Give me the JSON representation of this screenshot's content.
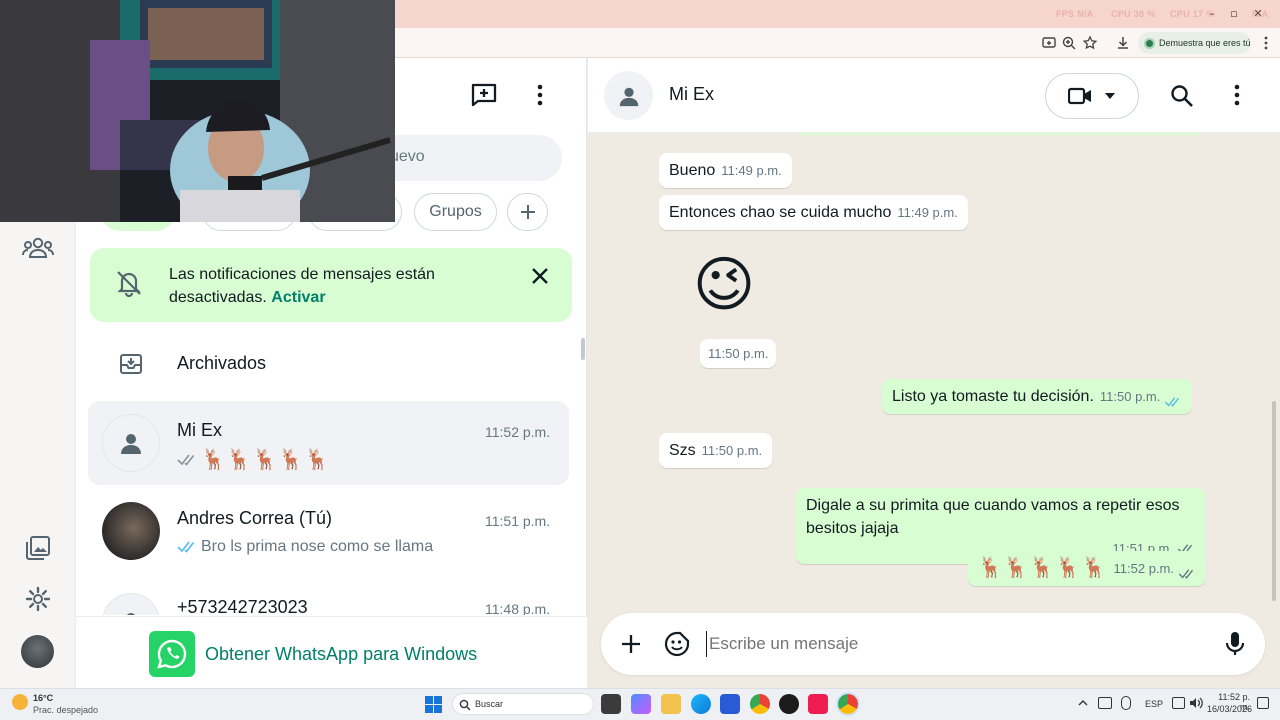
{
  "browser": {
    "perf": [
      "FPS N/A",
      "CPU 38 %",
      "CPU 17 %",
      "N/A"
    ],
    "verify_pill": "Demuestra que eres tú"
  },
  "sidebar": {
    "search_placeholder": "uevo",
    "filters": [
      "Grupos"
    ],
    "notification": {
      "text": "Las notificaciones de mensajes están desactivadas.",
      "action": "Activar"
    },
    "archived_label": "Archivados",
    "chats": [
      {
        "name": "Mi Ex",
        "time": "11:52 p.m.",
        "preview": "🦌🦌🦌🦌🦌"
      },
      {
        "name": "Andres Correa (Tú)",
        "time": "11:51 p.m.",
        "preview": "Bro ls prima nose como se llama"
      },
      {
        "name": "+573242723023",
        "time": "11:48 p.m.",
        "preview": ""
      }
    ],
    "get_app": "Obtener WhatsApp para Windows"
  },
  "conversation": {
    "contact_name": "Mi Ex",
    "messages": [
      {
        "dir": "in",
        "text": "Bueno",
        "time": "11:49 p.m."
      },
      {
        "dir": "in",
        "text": "Entonces chao se cuida mucho",
        "time": "11:49 p.m."
      },
      {
        "dir": "in",
        "text": "😉",
        "time": "11:50 p.m."
      },
      {
        "dir": "out",
        "text": "Listo ya tomaste tu decisión.",
        "time": "11:50 p.m.",
        "status": "read"
      },
      {
        "dir": "in",
        "text": "Szs",
        "time": "11:50 p.m."
      },
      {
        "dir": "out",
        "text": "Digale a su primita que cuando vamos a repetir esos besitos jajaja",
        "time": "11:51 p.m.",
        "status": "delivered"
      },
      {
        "dir": "out",
        "text": "🦌🦌🦌🦌🦌",
        "time": "11:52 p.m.",
        "status": "delivered"
      }
    ],
    "composer_placeholder": "Escribe un mensaje"
  },
  "taskbar": {
    "weather_temp": "16°C",
    "weather_desc": "Prac. despejado",
    "search_label": "Buscar",
    "lang": "ESP",
    "time": "11:52 p. m.",
    "date": "16/03/2026"
  },
  "colors": {
    "accent": "#008069",
    "outgoing_bubble": "#d9fdd3",
    "read_tick": "#53bdeb",
    "notification_bg": "#d9fdd3"
  }
}
